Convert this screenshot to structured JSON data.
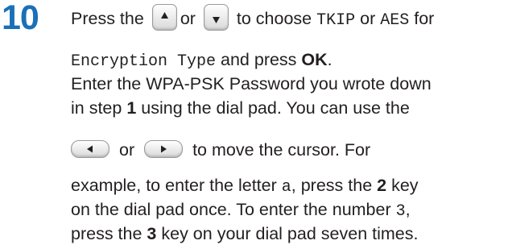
{
  "step": {
    "number": "10"
  },
  "lines": {
    "l1_a": "Press the",
    "l1_b": "or",
    "l1_c": "to choose",
    "l1_d": "TKIP",
    "l1_e": "or",
    "l1_f": "AES",
    "l1_g": "for",
    "l2_a": "Encryption Type",
    "l2_b": "and press",
    "l2_c": "OK",
    "l2_d": ".",
    "l3": "Enter the WPA-PSK Password you wrote down",
    "l4_a": "in step",
    "l4_b": "1",
    "l4_c": "using the dial pad. You can use the",
    "l5_a": "or",
    "l5_b": "to move the cursor. For",
    "l6_a": "example, to enter the letter",
    "l6_b": "a",
    "l6_c": ", press the",
    "l6_d": "2",
    "l6_e": "key",
    "l7_a": "on the dial pad once. To enter the number",
    "l7_b": "3",
    "l7_c": ",",
    "l8_a": "press the",
    "l8_b": "3",
    "l8_c": "key on your dial pad seven times."
  },
  "icons": {
    "up_key": "up-arrow-key-icon",
    "down_key": "down-arrow-key-icon",
    "left_key": "left-arrow-key-icon",
    "right_key": "right-arrow-key-icon"
  },
  "colors": {
    "step_number": "#1a70b8",
    "text": "#231f20"
  }
}
